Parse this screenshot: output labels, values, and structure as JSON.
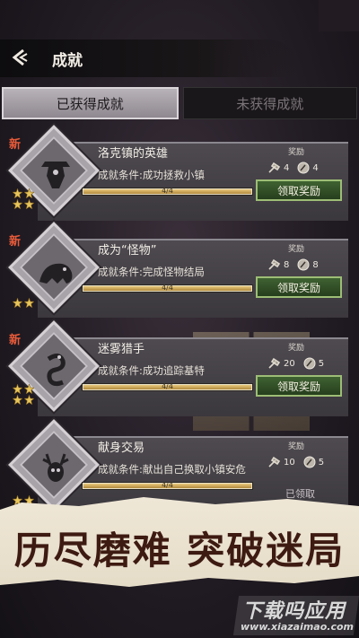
{
  "header": {
    "title": "成就"
  },
  "tabs": [
    {
      "label": "已获得成就",
      "active": true
    },
    {
      "label": "未获得成就",
      "active": false
    }
  ],
  "achievements": [
    {
      "new_tag": "新",
      "title": "洛克镇的英雄",
      "condition": "成就条件:成功拯救小镇",
      "reward_label": "奖励",
      "reward1": "4",
      "reward2": "4",
      "progress": "4/4",
      "progress_fraction": 1.0,
      "stars": 3,
      "button": "领取奖励",
      "emblem": "hooded-figure-icon"
    },
    {
      "new_tag": "新",
      "title": "成为“怪物”",
      "condition": "成就条件:完成怪物结局",
      "reward_label": "奖励",
      "reward1": "8",
      "reward2": "8",
      "progress": "4/4",
      "progress_fraction": 1.0,
      "stars": 2,
      "button": "领取奖励",
      "emblem": "monster-icon"
    },
    {
      "new_tag": "新",
      "title": "迷雾猎手",
      "condition": "成就条件:成功追踪基特",
      "reward_label": "奖励",
      "reward1": "20",
      "reward2": "5",
      "progress": "4/4",
      "progress_fraction": 1.0,
      "stars": 3,
      "button": "领取奖励",
      "emblem": "serpent-icon"
    },
    {
      "new_tag": "",
      "title": "献身交易",
      "condition": "成就条件:献出自己换取小镇安危",
      "reward_label": "奖励",
      "reward1": "10",
      "reward2": "5",
      "progress": "4/4",
      "progress_fraction": 1.0,
      "stars": 2,
      "button": "",
      "claimed": "已领取",
      "emblem": "antlered-skull-icon"
    }
  ],
  "banner": {
    "text": "历尽磨难 突破迷局"
  },
  "watermark": {
    "brand": "下载吗应用",
    "url": "www.xiazaimao.com"
  },
  "colors": {
    "accent_green": "#3f6232",
    "progress_gold": "#d4ad5e",
    "new_tag": "#e85b3a"
  }
}
